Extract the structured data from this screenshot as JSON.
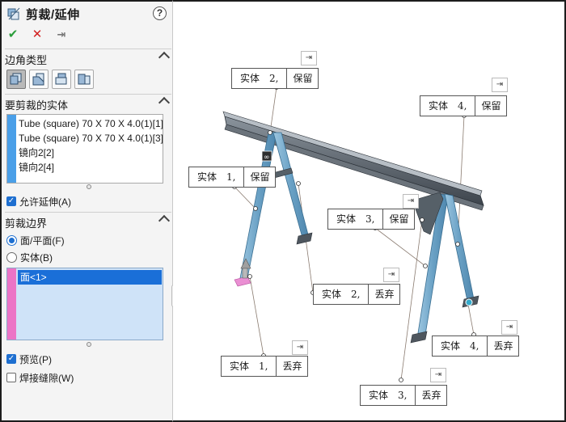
{
  "panel": {
    "title": "剪裁/延伸",
    "help": "?",
    "actions": {
      "ok": "✔",
      "cancel": "✕",
      "pin": "⇥"
    },
    "corner_type": {
      "label": "边角类型",
      "buttons": [
        "end-trim-icon",
        "end-miter-icon",
        "end-butt1-icon",
        "end-butt2-icon"
      ],
      "selected_index": 0
    },
    "bodies_to_trim": {
      "label": "要剪裁的实体",
      "items": [
        "Tube (square) 70 X 70 X 4.0(1)[1]",
        "Tube (square) 70 X 70 X 4.0(1)[3]",
        "镜向2[2]",
        "镜向2[4]"
      ]
    },
    "allow_extend": {
      "label": "允许延伸(A)",
      "checked": true
    },
    "trim_boundary": {
      "label": "剪裁边界",
      "face_option": "面/平面(F)",
      "body_option": "实体(B)",
      "selected": "face",
      "items": [
        "面<1>"
      ]
    },
    "preview": {
      "label": "预览(P)",
      "checked": true
    },
    "weld_gap": {
      "label": "焊接缝隙(W)",
      "checked": false
    }
  },
  "viewport": {
    "callouts": [
      {
        "id": "keep-2",
        "body": "实体　2,",
        "action": "保留"
      },
      {
        "id": "keep-4",
        "body": "实体　4,",
        "action": "保留"
      },
      {
        "id": "keep-1",
        "body": "实体　1,",
        "action": "保留"
      },
      {
        "id": "keep-3",
        "body": "实体　3,",
        "action": "保留"
      },
      {
        "id": "discard-2",
        "body": "实体　2,",
        "action": "丢弃"
      },
      {
        "id": "discard-4",
        "body": "实体　4,",
        "action": "丢弃"
      },
      {
        "id": "discard-1",
        "body": "实体　1,",
        "action": "丢弃"
      },
      {
        "id": "discard-3",
        "body": "实体　3,",
        "action": "丢弃"
      }
    ],
    "pin_glyph": "⇥"
  },
  "colors": {
    "accent": "#1a6fd8",
    "body_list_stripe": "#4a9fe8",
    "boundary_stripe": "#ec74c6",
    "beam": "#5a6470",
    "tube": "#7fb0cf",
    "ok": "#2a9d3a",
    "cancel": "#d21f1f"
  }
}
